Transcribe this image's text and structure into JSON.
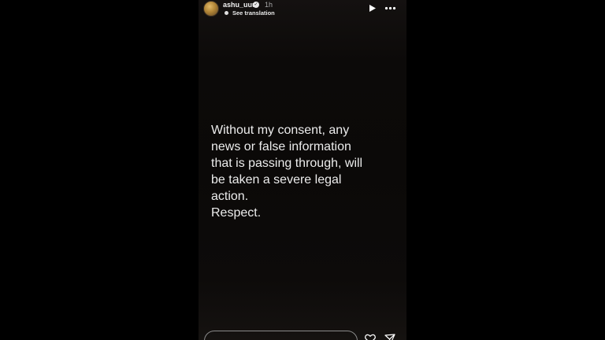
{
  "header": {
    "username": "ashu_uuu",
    "time": "1h",
    "translation_link": "See translation"
  },
  "story": {
    "text": "Without my consent, any\nnews or false information\nthat is passing through, will\nbe taken a severe legal\naction.\nRespect."
  },
  "icons": {
    "avatar": "profile-avatar",
    "verified": "verified-badge-icon",
    "play": "play-icon",
    "more": "more-options-icon",
    "like": "heart-icon",
    "share": "share-icon"
  },
  "colors": {
    "background": "#000000",
    "story_background": "#0b0908",
    "text": "#ececec"
  }
}
